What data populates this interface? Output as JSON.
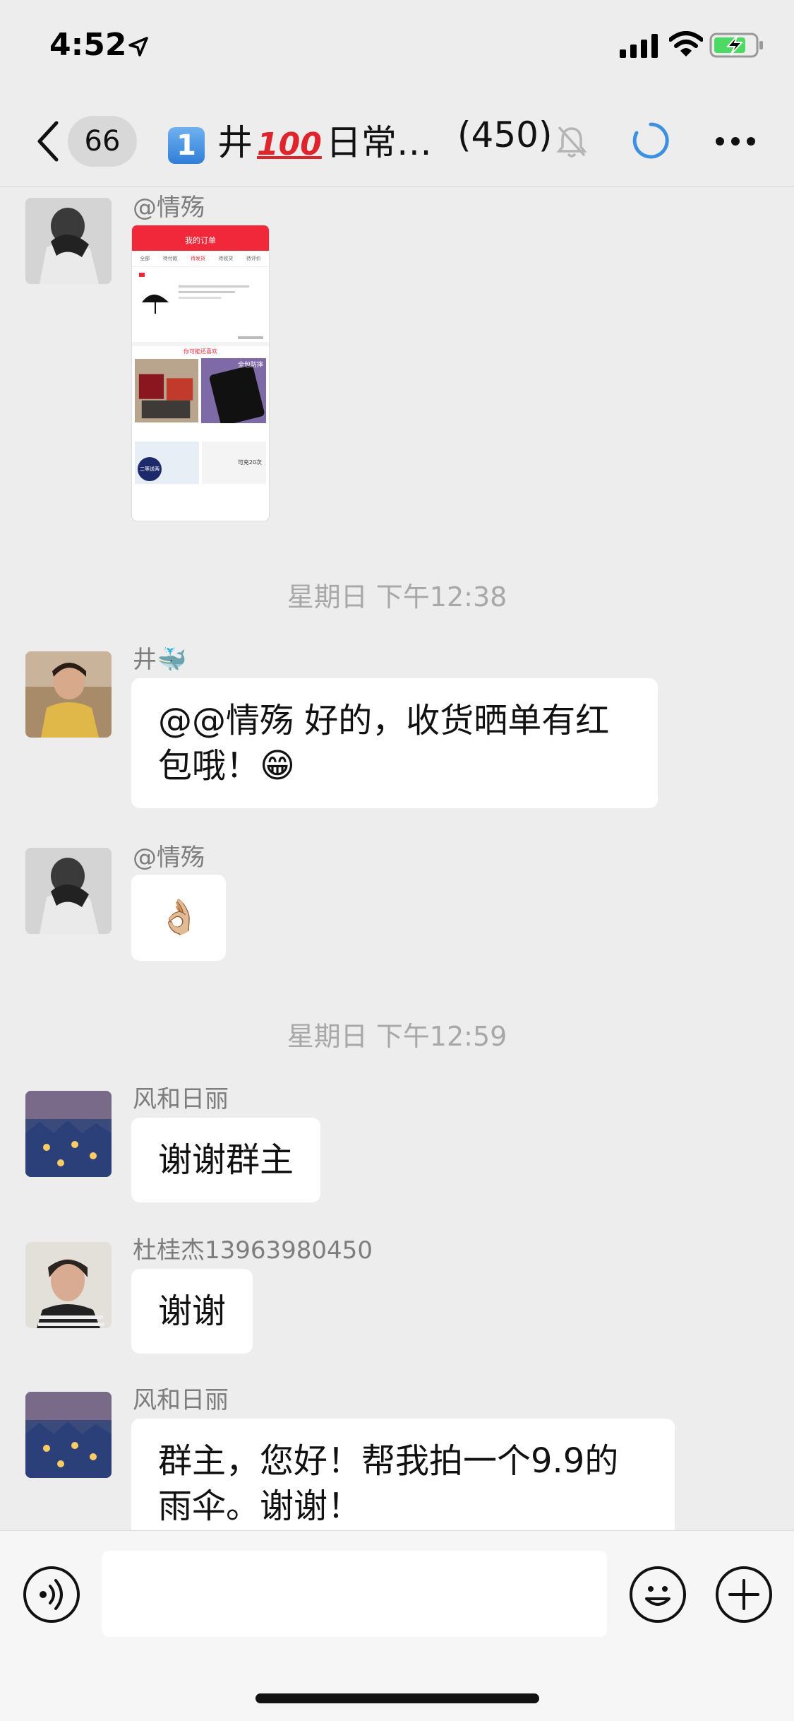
{
  "status_bar": {
    "time": "4:52"
  },
  "header": {
    "back_count": "66",
    "title_num": "1",
    "title_text": "井",
    "title_hundred": "100",
    "title_rest": "日常…",
    "member_count": "(450)"
  },
  "messages": [
    {
      "sender": "@情殇",
      "type": "image"
    },
    {
      "timestamp": "星期日 下午12:38"
    },
    {
      "sender": "井🐳",
      "text": "@@情殇 好的，收货晒单有红包哦！😁"
    },
    {
      "sender": "@情殇",
      "text": "👌🏼"
    },
    {
      "timestamp": "星期日 下午12:59"
    },
    {
      "sender": "风和日丽",
      "text": "谢谢群主"
    },
    {
      "sender": "杜桂杰13963980450",
      "text": "谢谢"
    },
    {
      "sender": "风和日丽",
      "text": "群主，您好！帮我拍一个9.9的雨伞。谢谢！"
    }
  ],
  "screenshot_thumbnail": {
    "header_title": "我的订单",
    "tabs": [
      "全部",
      "待付款",
      "待发货",
      "待收货",
      "待评价"
    ],
    "recommend_label": "你可能还喜欢",
    "item_badge": "全包防摔",
    "coupon_label": "二等送两件",
    "charge_label": "可充20次"
  },
  "input": {
    "placeholder": ""
  },
  "colors": {
    "background": "#EDEDED",
    "bubble": "#FFFFFF",
    "accent_red": "#E0242B",
    "loading_blue": "#3D8FE0"
  }
}
